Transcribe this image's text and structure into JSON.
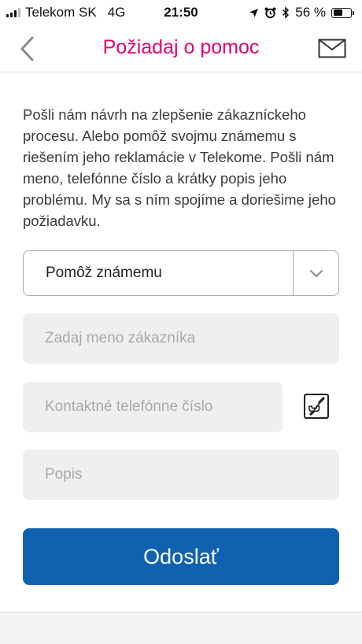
{
  "status_bar": {
    "carrier": "Telekom SK",
    "network": "4G",
    "time": "21:50",
    "battery_percent": "56 %",
    "battery_level": 0.56,
    "icons": [
      "location-icon",
      "alarm-icon",
      "bluetooth-icon"
    ]
  },
  "nav": {
    "title": "Požiadaj o pomoc",
    "back_icon": "chevron-left-icon",
    "mail_icon": "envelope-icon"
  },
  "intro_text": "Pošli nám návrh na zlepšenie zákazníckeho procesu. Alebo pomôž svojmu známemu s riešením jeho reklamácie v Telekome. Pošli nám meno, telefónne číslo a krátky popis jeho problému. My sa s ním spojíme a doriešime jeho požiadavku.",
  "form": {
    "request_type": "Pomôž známemu",
    "customer_name_placeholder": "Zadaj meno zákazníka",
    "phone_placeholder": "Kontaktné telefónne číslo",
    "description_placeholder": "Popis",
    "submit_label": "Odoslať"
  },
  "colors": {
    "accent": "#e20074",
    "button": "#1062b0",
    "field_bg": "#efefef"
  }
}
